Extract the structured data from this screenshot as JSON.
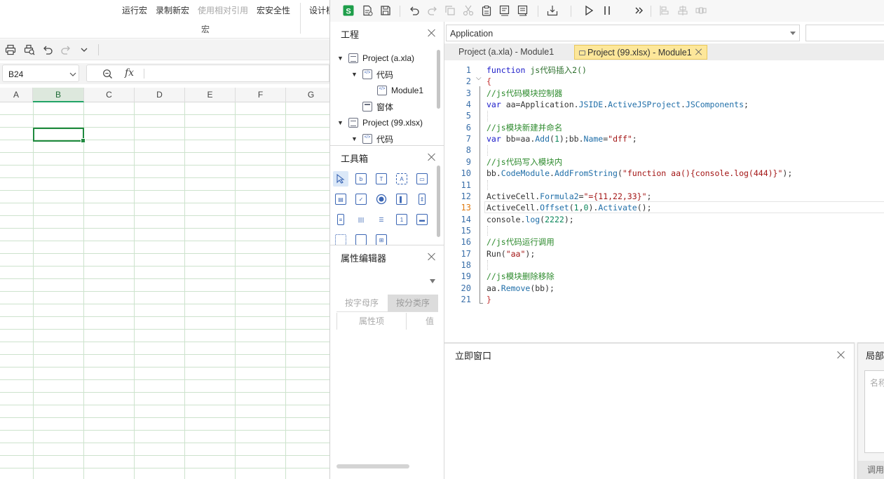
{
  "spreadsheet": {
    "ribbon": {
      "buttons": [
        {
          "label": "运行宏",
          "disabled": false
        },
        {
          "label": "录制新宏",
          "disabled": false
        },
        {
          "label": "使用相对引用",
          "disabled": true
        },
        {
          "label": "宏安全性",
          "disabled": false
        }
      ],
      "group_label": "宏",
      "next_group_label": "设计模式"
    },
    "quick_access": [
      "print-icon",
      "print-preview-icon",
      "undo-icon",
      "redo-icon",
      "chevron-down-icon"
    ],
    "name_box": "B24",
    "formula_fx": "fx",
    "formula_value": "",
    "columns": [
      "A",
      "B",
      "C",
      "D",
      "E",
      "F",
      "G"
    ],
    "selected_column": "B"
  },
  "ide": {
    "toolbar_icons": [
      "wps-s-icon",
      "insert-module-icon",
      "save-icon",
      "undo-icon",
      "redo-icon",
      "copy-icon",
      "cut-icon",
      "paste-icon",
      "find-icon",
      "find-replace-icon",
      "import-icon",
      "run-icon",
      "pause-icon",
      "step-more-icon",
      "align-left-icon",
      "align-center-icon",
      "distribute-icon"
    ],
    "project_panel": {
      "title": "工程",
      "tree": [
        {
          "label": "Project (a.xla)",
          "level": 0,
          "icon": "project-icon",
          "expanded": true
        },
        {
          "label": "代码",
          "level": 1,
          "icon": "code-folder-icon",
          "expanded": true
        },
        {
          "label": "Module1",
          "level": 2,
          "icon": "module-icon"
        },
        {
          "label": "窗体",
          "level": 1,
          "icon": "form-folder-icon"
        },
        {
          "label": "Project (99.xlsx)",
          "level": 0,
          "icon": "project-icon",
          "expanded": true
        },
        {
          "label": "代码",
          "level": 1,
          "icon": "code-folder-icon",
          "expanded": true
        }
      ]
    },
    "toolbox_panel": {
      "title": "工具箱",
      "tools": [
        "pointer-tool-icon",
        "button-tool-icon",
        "label-tool-icon",
        "textbox-tool-icon",
        "frame-tool-icon",
        "combobox-tool-icon",
        "checkbox-tool-icon",
        "radio-tool-icon",
        "toggle-tool-icon",
        "spin-tool-icon",
        "scroll-tool-icon",
        "image-tool-icon",
        "listbox-tool-icon",
        "number-tool-icon",
        "refedit-tool-icon",
        "tabstrip-tool-icon",
        "multipage-tool-icon",
        "grid-tool-icon"
      ]
    },
    "property_panel": {
      "title": "属性编辑器",
      "sort_alpha": "按字母序",
      "sort_category": "按分类序",
      "col_item": "属性项",
      "col_value": "值"
    },
    "editor": {
      "object_combo": "Application",
      "proc_combo": "",
      "tabs": [
        {
          "label": "Project (a.xla) - Module1",
          "active": false
        },
        {
          "label": "Project (99.xlsx) - Module1",
          "active": true
        }
      ],
      "current_line": 13,
      "lines": [
        {
          "n": "1",
          "tokens": [
            [
              "kw",
              "function "
            ],
            [
              "cm-dark",
              "js代码插入2()"
            ]
          ]
        },
        {
          "n": "2",
          "tokens": [
            [
              "br",
              "{"
            ]
          ]
        },
        {
          "n": "3",
          "tokens": [
            [
              "cm",
              "//js代码模块控制器"
            ]
          ]
        },
        {
          "n": "4",
          "tokens": [
            [
              "kw",
              "var "
            ],
            [
              "tx",
              "aa=Application."
            ],
            [
              "mem",
              "JSIDE"
            ],
            [
              "tx",
              "."
            ],
            [
              "mem",
              "ActiveJSProject"
            ],
            [
              "tx",
              "."
            ],
            [
              "mem",
              "JSComponents"
            ],
            [
              "tx",
              ";"
            ]
          ]
        },
        {
          "n": "5",
          "tokens": []
        },
        {
          "n": "6",
          "tokens": [
            [
              "cm",
              "//js模块新建并命名"
            ]
          ]
        },
        {
          "n": "7",
          "tokens": [
            [
              "kw",
              "var "
            ],
            [
              "tx",
              "bb=aa."
            ],
            [
              "mem",
              "Add"
            ],
            [
              "tx",
              "("
            ],
            [
              "num",
              "1"
            ],
            [
              "tx",
              ");bb."
            ],
            [
              "mem",
              "Name"
            ],
            [
              "tx",
              "="
            ],
            [
              "str",
              "\"dff\""
            ],
            [
              "tx",
              ";"
            ]
          ]
        },
        {
          "n": "8",
          "tokens": []
        },
        {
          "n": "9",
          "tokens": [
            [
              "cm",
              "//js代码写入模块内"
            ]
          ]
        },
        {
          "n": "10",
          "tokens": [
            [
              "tx",
              "bb."
            ],
            [
              "mem",
              "CodeModule"
            ],
            [
              "tx",
              "."
            ],
            [
              "mem",
              "AddFromString"
            ],
            [
              "tx",
              "("
            ],
            [
              "str",
              "\"function aa(){console.log(444)}\""
            ],
            [
              "tx",
              ");"
            ]
          ]
        },
        {
          "n": "11",
          "tokens": []
        },
        {
          "n": "12",
          "tokens": [
            [
              "tx",
              "ActiveCell."
            ],
            [
              "mem",
              "Formula2"
            ],
            [
              "tx",
              "="
            ],
            [
              "str",
              "\"={11,22,33}\""
            ],
            [
              "tx",
              ";"
            ]
          ]
        },
        {
          "n": "13",
          "tokens": [
            [
              "tx",
              "ActiveCell."
            ],
            [
              "mem",
              "Offset"
            ],
            [
              "tx",
              "("
            ],
            [
              "num",
              "1"
            ],
            [
              "tx",
              ","
            ],
            [
              "num",
              "0"
            ],
            [
              "tx",
              ")."
            ],
            [
              "mem",
              "Activate"
            ],
            [
              "tx",
              "();"
            ]
          ]
        },
        {
          "n": "14",
          "tokens": [
            [
              "tx",
              "console."
            ],
            [
              "mem",
              "log"
            ],
            [
              "tx",
              "("
            ],
            [
              "num",
              "2222"
            ],
            [
              "tx",
              ");"
            ]
          ]
        },
        {
          "n": "15",
          "tokens": []
        },
        {
          "n": "16",
          "tokens": [
            [
              "cm",
              "//js代码运行调用"
            ]
          ]
        },
        {
          "n": "17",
          "tokens": [
            [
              "tx",
              "Run("
            ],
            [
              "str",
              "\"aa\""
            ],
            [
              "tx",
              ");"
            ]
          ]
        },
        {
          "n": "18",
          "tokens": []
        },
        {
          "n": "19",
          "tokens": [
            [
              "cm",
              "//js模块删除移除"
            ]
          ]
        },
        {
          "n": "20",
          "tokens": [
            [
              "tx",
              "aa."
            ],
            [
              "mem",
              "Remove"
            ],
            [
              "tx",
              "(bb);"
            ]
          ]
        },
        {
          "n": "21",
          "tokens": [
            [
              "br",
              "}"
            ]
          ]
        }
      ]
    },
    "immediate_panel": {
      "title": "立即窗口"
    },
    "locals_panel": {
      "title": "局部",
      "name_header": "名称",
      "bottom_tab": "调用"
    }
  },
  "colors": {
    "keyword": "#1b1bc9",
    "comment": "#2c8a2c",
    "string": "#a31515",
    "member": "#1f6ea8",
    "active_tab": "#fde79a",
    "grid_line": "#cde3cd",
    "selection": "#1f8a3f"
  }
}
